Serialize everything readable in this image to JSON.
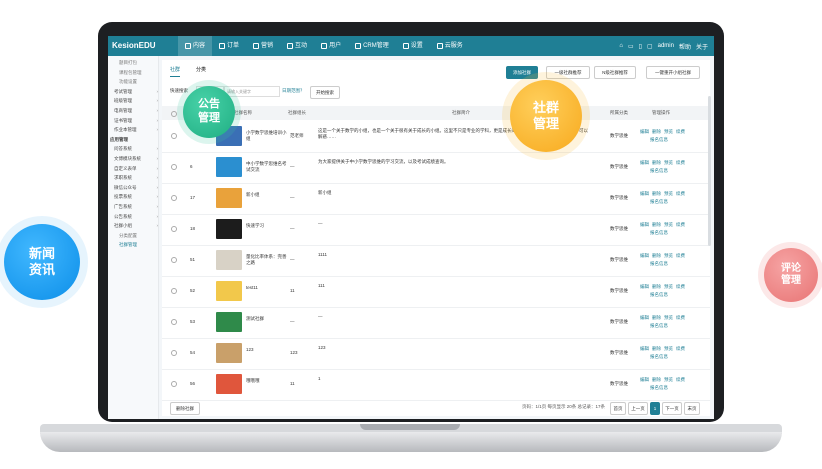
{
  "brand": "KesionEDU",
  "top_menu": [
    {
      "label": "内容",
      "icon": "book-icon",
      "active": true
    },
    {
      "label": "订单",
      "icon": "order-icon"
    },
    {
      "label": "营销",
      "icon": "tag-icon"
    },
    {
      "label": "互动",
      "icon": "chat-icon"
    },
    {
      "label": "用户",
      "icon": "user-icon"
    },
    {
      "label": "CRM管理",
      "icon": "crm-icon"
    },
    {
      "label": "设置",
      "icon": "gear-icon"
    },
    {
      "label": "云服务",
      "icon": "cloud-icon"
    }
  ],
  "top_right": {
    "user": "admin",
    "help": "帮助",
    "about": "关于"
  },
  "sidebar": {
    "items": [
      {
        "label": "题目打包",
        "sub": true
      },
      {
        "label": "课程包管理",
        "sub": true
      },
      {
        "label": "功能设置",
        "sub": true
      },
      {
        "label": "考试管理",
        "arrow": true
      },
      {
        "label": "班级管理",
        "arrow": true
      },
      {
        "label": "电商管理",
        "arrow": true
      },
      {
        "label": "证书管理",
        "arrow": true
      },
      {
        "label": "作业本管理",
        "arrow": true
      },
      {
        "label": "应用管理",
        "section": true
      },
      {
        "label": "问答系统",
        "arrow": true
      },
      {
        "label": "文博模块系统",
        "arrow": true
      },
      {
        "label": "自定义表单",
        "arrow": true
      },
      {
        "label": "求职系统",
        "arrow": true
      },
      {
        "label": "微信公众号",
        "arrow": true
      },
      {
        "label": "投票系统",
        "arrow": true
      },
      {
        "label": "广告系统",
        "arrow": true
      },
      {
        "label": "公告系统",
        "arrow": true
      },
      {
        "label": "社群小组",
        "arrow": true
      },
      {
        "label": "分类配置",
        "sub": true
      },
      {
        "label": "社群管理",
        "sub": true,
        "active": true
      }
    ]
  },
  "tabs": [
    {
      "label": "社群",
      "active": true
    },
    {
      "label": "分类"
    }
  ],
  "toolbar": {
    "add_label": "添加社群",
    "btn2": "一级社群推荐",
    "btn3": "N级社群推荐",
    "btn4": "一键重开小组社群"
  },
  "filter": {
    "label": "快速搜索",
    "select": "名称",
    "placeholder": "请输入关键字",
    "link": "日期范围？",
    "search": "开始搜索"
  },
  "table": {
    "headers": [
      "ID",
      "社群名称",
      "社群组长",
      "社群简介",
      "所属分类",
      "管理操作"
    ],
    "rows": [
      {
        "id": "",
        "name": "小学数学思维培训小组",
        "leader": "范老师",
        "intro": "这是一个关于数学的小组，也是一个关于很有关于成长的小组。这里不只是专业的学科，更是成长的平台……可以提问，可以交流，可以解惑……",
        "category": "数学思维",
        "thumb": "#3a6fb5"
      },
      {
        "id": "6",
        "name": "中小学数学思维名考试交流",
        "leader": "—",
        "intro": "为大家提供关于中小学数学思维的学习交流，以及考试成绩查询。",
        "category": "数学思维",
        "thumb": "#2b8fd0"
      },
      {
        "id": "17",
        "name": "新小组",
        "leader": "—",
        "intro": "新小组",
        "category": "数学思维",
        "thumb": "#e9a23b"
      },
      {
        "id": "18",
        "name": "快速学习",
        "leader": "—",
        "intro": "—",
        "category": "数学思维",
        "thumb": "#1c1c1c"
      },
      {
        "id": "51",
        "name": "量化比率体系：完善之路",
        "leader": "—",
        "intro": "1111",
        "category": "数学思维",
        "thumb": "#d8d2c6"
      },
      {
        "id": "52",
        "name": "test11",
        "leader": "11",
        "intro": "111",
        "category": "数学思维",
        "thumb": "#f2c84b"
      },
      {
        "id": "53",
        "name": "测试社群",
        "leader": "—",
        "intro": "—",
        "category": "数学思维",
        "thumb": "#2f8a4a"
      },
      {
        "id": "54",
        "name": "123",
        "leader": "123",
        "intro": "123",
        "category": "数学思维",
        "thumb": "#c9a06a"
      },
      {
        "id": "56",
        "name": "哦哦哦",
        "leader": "11",
        "intro": "1",
        "category": "数学思维",
        "thumb": "#e0563c"
      }
    ],
    "ops": [
      "编辑",
      "删除",
      "预览",
      "续费",
      "报名信息"
    ]
  },
  "footer": {
    "delete": "删除社群",
    "pager": "页码：1/1页 每页显示 20条 总记录：17条",
    "first": "首页",
    "prev": "上一页",
    "page": "1",
    "next": "下一页",
    "last": "末页"
  },
  "bubbles": {
    "news": [
      "新闻",
      "资讯"
    ],
    "notice": [
      "公告",
      "管理"
    ],
    "social": [
      "社群",
      "管理"
    ],
    "comment": [
      "评论",
      "管理"
    ]
  }
}
